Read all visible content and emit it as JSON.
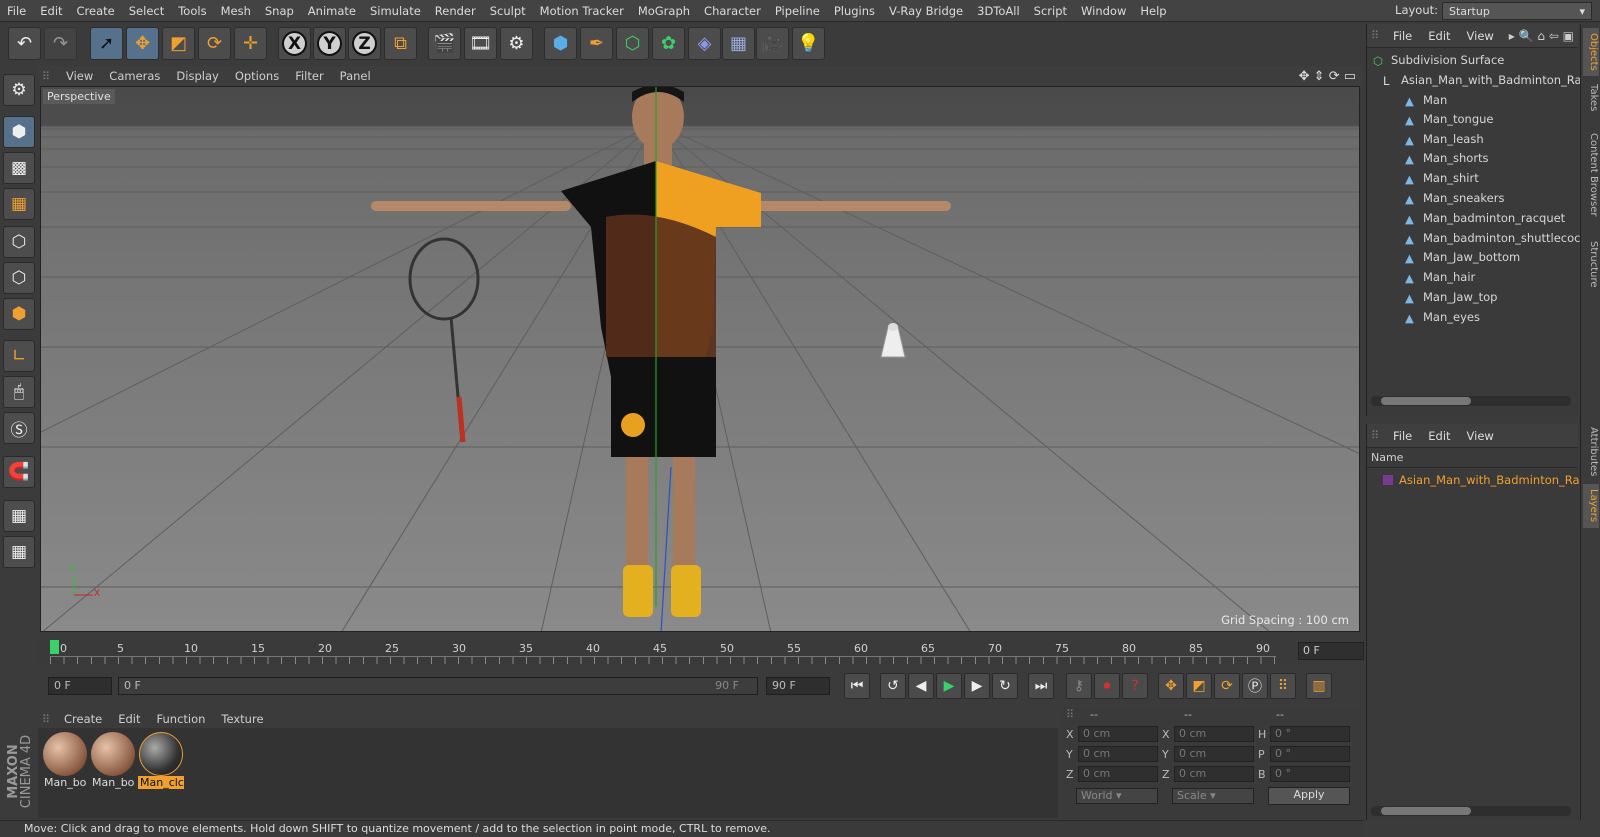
{
  "menubar": {
    "items": [
      "File",
      "Edit",
      "Create",
      "Select",
      "Tools",
      "Mesh",
      "Snap",
      "Animate",
      "Simulate",
      "Render",
      "Sculpt",
      "Motion Tracker",
      "MoGraph",
      "Character",
      "Pipeline",
      "Plugins",
      "V-Ray Bridge",
      "3DToAll",
      "Script",
      "Window",
      "Help"
    ],
    "layout_label": "Layout:",
    "layout_value": "Startup"
  },
  "viewport": {
    "menu": [
      "View",
      "Cameras",
      "Display",
      "Options",
      "Filter",
      "Panel"
    ],
    "camera_label": "Perspective",
    "grid_spacing": "Grid Spacing : 100 cm",
    "axis_x": "X",
    "axis_y": "Y"
  },
  "timeline": {
    "ticks": [
      "0",
      "5",
      "10",
      "15",
      "20",
      "25",
      "30",
      "35",
      "40",
      "45",
      "50",
      "55",
      "60",
      "65",
      "70",
      "75",
      "80",
      "85",
      "90"
    ],
    "current_frame": "0 F",
    "start_field": "0 F",
    "slider_start": "0 F",
    "slider_end": "90 F",
    "end_field": "90 F"
  },
  "materials": {
    "menu": [
      "Create",
      "Edit",
      "Function",
      "Texture"
    ],
    "items": [
      {
        "label": "Man_bo",
        "selected": false
      },
      {
        "label": "Man_bo",
        "selected": false
      },
      {
        "label": "Man_clc",
        "selected": true
      }
    ]
  },
  "coords": {
    "col1_header": "--",
    "col2_header": "--",
    "col3_header": "--",
    "rows": [
      {
        "k1": "X",
        "v1": "0 cm",
        "k2": "X",
        "v2": "0 cm",
        "k3": "H",
        "v3": "0 °"
      },
      {
        "k1": "Y",
        "v1": "0 cm",
        "k2": "Y",
        "v2": "0 cm",
        "k3": "P",
        "v3": "0 °"
      },
      {
        "k1": "Z",
        "v1": "0 cm",
        "k2": "Z",
        "v2": "0 cm",
        "k3": "B",
        "v3": "0 °"
      }
    ],
    "mode_world": "World",
    "mode_scale": "Scale",
    "apply_label": "Apply"
  },
  "status": {
    "text": "Move: Click and drag to move elements. Hold down SHIFT to quantize movement / add to the selection in point mode, CTRL to remove."
  },
  "brand": {
    "line1": "MAXON",
    "line2": "CINEMA 4D"
  },
  "object_manager": {
    "menu": [
      "File",
      "Edit",
      "View"
    ],
    "root": "Subdivision Surface",
    "group": "Asian_Man_with_Badminton_Rac",
    "children": [
      "Man",
      "Man_tongue",
      "Man_leash",
      "Man_shorts",
      "Man_shirt",
      "Man_sneakers",
      "Man_badminton_racquet",
      "Man_badminton_shuttlecock",
      "Man_Jaw_bottom",
      "Man_hair",
      "Man_Jaw_top",
      "Man_eyes"
    ]
  },
  "layers_manager": {
    "menu": [
      "File",
      "Edit",
      "View"
    ],
    "column_name": "Name",
    "layer": "Asian_Man_with_Badminton_Rack"
  },
  "side_tabs": [
    "Objects",
    "Takes",
    "Content Browser",
    "Structure",
    "Attributes",
    "Layers"
  ],
  "colors": {
    "accent": "#f0a030",
    "active_tool": "#56718c",
    "layer_text": "#f0a030"
  }
}
